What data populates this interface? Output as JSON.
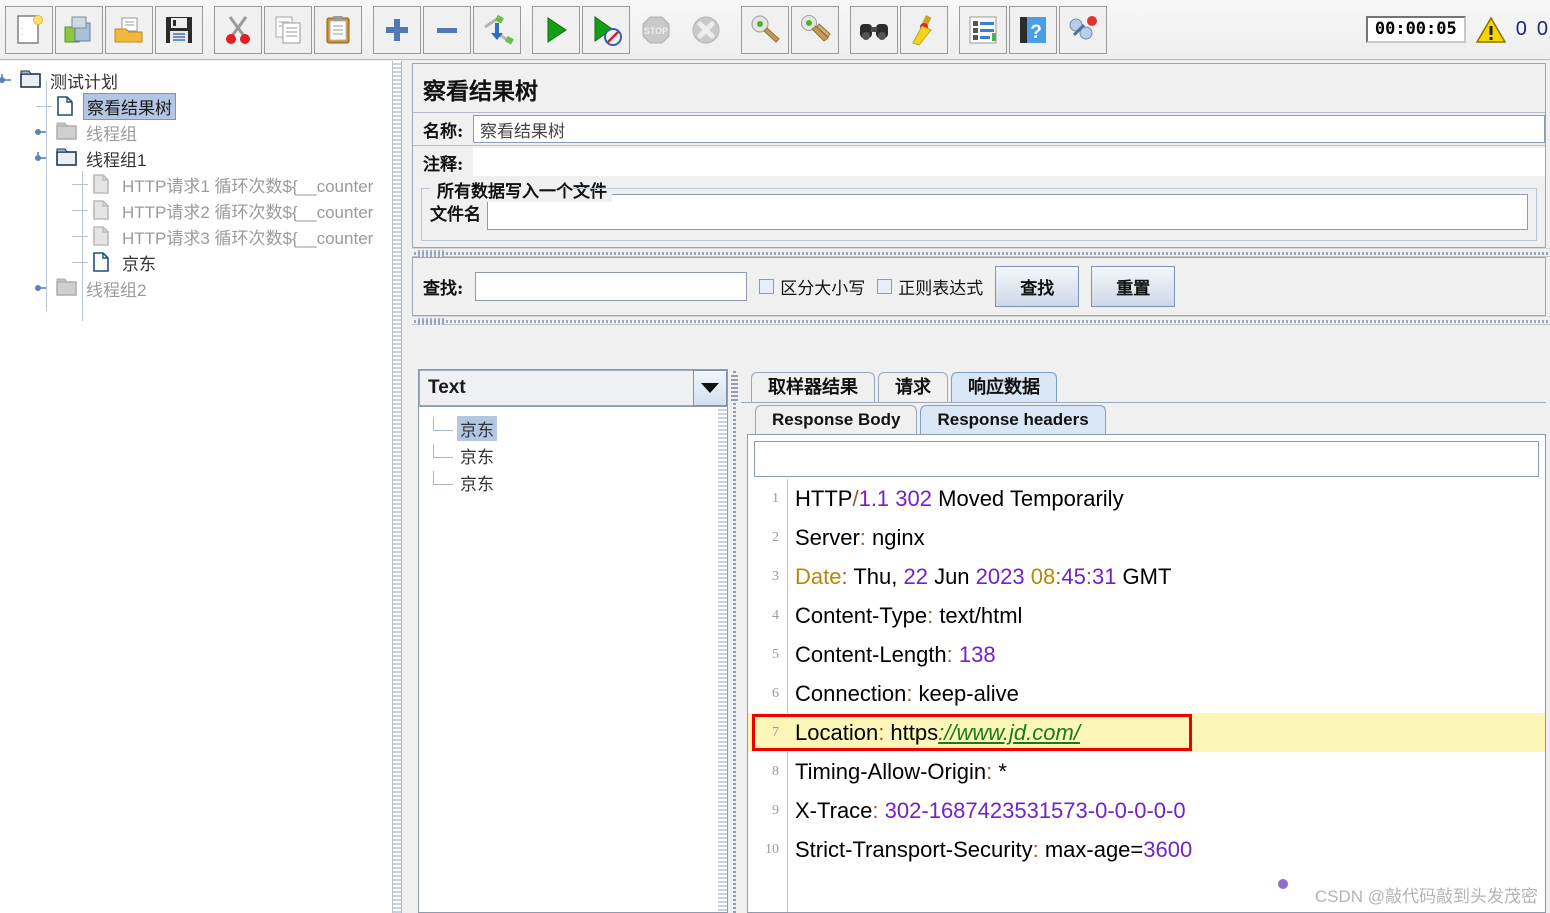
{
  "toolbar": {
    "buttons": [
      {
        "name": "new-icon",
        "title": "New"
      },
      {
        "name": "templates-icon",
        "title": "Templates"
      },
      {
        "name": "open-icon",
        "title": "Open"
      },
      {
        "name": "save-icon",
        "title": "Save"
      },
      {
        "name": "cut-icon",
        "title": "Cut"
      },
      {
        "name": "copy-icon",
        "title": "Copy"
      },
      {
        "name": "paste-icon",
        "title": "Paste"
      },
      {
        "name": "expand-all-icon",
        "title": "Expand all"
      },
      {
        "name": "collapse-all-icon",
        "title": "Collapse all"
      },
      {
        "name": "toggle-icon",
        "title": "Toggle"
      },
      {
        "name": "start-icon",
        "title": "Start"
      },
      {
        "name": "start-no-pauses-icon",
        "title": "Start no pauses"
      },
      {
        "name": "stop-icon",
        "title": "Stop"
      },
      {
        "name": "shutdown-icon",
        "title": "Shutdown"
      },
      {
        "name": "clear-icon",
        "title": "Clear"
      },
      {
        "name": "clear-all-icon",
        "title": "Clear all"
      },
      {
        "name": "search-icon",
        "title": "Search"
      },
      {
        "name": "reset-search-icon",
        "title": "Reset search"
      },
      {
        "name": "function-helper-icon",
        "title": "Function helper"
      },
      {
        "name": "help-icon",
        "title": "Help"
      },
      {
        "name": "undo-redo-icon",
        "title": "Undo"
      }
    ],
    "timer": "00:00:05",
    "warnings_count": "0",
    "extra_count": "0"
  },
  "tree": {
    "nodes": [
      {
        "label": "测试计划",
        "icon": "folder-open-icon",
        "indent": 20,
        "selected": false,
        "dim": false,
        "handle": "expanded"
      },
      {
        "label": "察看结果树",
        "icon": "page-icon",
        "indent": 56,
        "selected": true,
        "dim": false,
        "handle": "none"
      },
      {
        "label": "线程组",
        "icon": "folder-icon",
        "indent": 56,
        "selected": false,
        "dim": true,
        "handle": "collapsed"
      },
      {
        "label": "线程组1",
        "icon": "folder-open-icon",
        "indent": 56,
        "selected": false,
        "dim": false,
        "handle": "expanded"
      },
      {
        "label": "HTTP请求1 循环次数${__counter",
        "icon": "page-dim-icon",
        "indent": 92,
        "selected": false,
        "dim": true,
        "handle": "none"
      },
      {
        "label": "HTTP请求2 循环次数${__counter",
        "icon": "page-dim-icon",
        "indent": 92,
        "selected": false,
        "dim": true,
        "handle": "none"
      },
      {
        "label": "HTTP请求3 循环次数${__counter",
        "icon": "page-dim-icon",
        "indent": 92,
        "selected": false,
        "dim": true,
        "handle": "none"
      },
      {
        "label": "京东",
        "icon": "page-icon",
        "indent": 92,
        "selected": false,
        "dim": false,
        "handle": "none"
      },
      {
        "label": "线程组2",
        "icon": "folder-icon",
        "indent": 56,
        "selected": false,
        "dim": true,
        "handle": "collapsed"
      }
    ]
  },
  "panel": {
    "title": "察看结果树",
    "name_label": "名称:",
    "name_value": "察看结果树",
    "comment_label": "注释:",
    "comment_value": "",
    "group_legend": "所有数据写入一个文件",
    "filename_label": "文件名",
    "filename_value": ""
  },
  "search": {
    "label": "查找:",
    "value": "",
    "case_sensitive_label": "区分大小写",
    "regex_label": "正则表达式",
    "find_button": "查找",
    "reset_button": "重置"
  },
  "results": {
    "renderer_selected": "Text",
    "items": [
      {
        "label": "京东",
        "selected": true
      },
      {
        "label": "京东",
        "selected": false
      },
      {
        "label": "京东",
        "selected": false
      }
    ]
  },
  "tabs": {
    "main": [
      {
        "label": "取样器结果",
        "active": false
      },
      {
        "label": "请求",
        "active": false
      },
      {
        "label": "响应数据",
        "active": true
      }
    ],
    "sub": [
      {
        "label": "Response Body",
        "active": false
      },
      {
        "label": "Response headers",
        "active": true
      }
    ]
  },
  "filter": {
    "value": ""
  },
  "response_headers": {
    "highlight_line": 7,
    "lines": [
      {
        "n": "1",
        "parts": [
          {
            "t": "HTTP",
            "c": "k-default"
          },
          {
            "t": "/",
            "c": "v-punct"
          },
          {
            "t": "1.1",
            "c": "v-num"
          },
          {
            "t": " ",
            "c": "k-default"
          },
          {
            "t": "302",
            "c": "v-num"
          },
          {
            "t": " Moved Temporarily",
            "c": "k-default"
          }
        ]
      },
      {
        "n": "2",
        "parts": [
          {
            "t": "Server",
            "c": "k-default"
          },
          {
            "t": ":",
            "c": "v-punct"
          },
          {
            "t": " nginx",
            "c": "k-default"
          }
        ]
      },
      {
        "n": "3",
        "parts": [
          {
            "t": "Date",
            "c": "k-date"
          },
          {
            "t": ":",
            "c": "v-punct"
          },
          {
            "t": " Thu, ",
            "c": "k-default"
          },
          {
            "t": "22",
            "c": "v-num"
          },
          {
            "t": " Jun ",
            "c": "k-default"
          },
          {
            "t": "2023",
            "c": "v-num"
          },
          {
            "t": " ",
            "c": "k-default"
          },
          {
            "t": "08",
            "c": "k-date"
          },
          {
            "t": ":",
            "c": "v-punct"
          },
          {
            "t": "45",
            "c": "v-num"
          },
          {
            "t": ":",
            "c": "v-punct"
          },
          {
            "t": "31",
            "c": "v-num"
          },
          {
            "t": " GMT",
            "c": "k-default"
          }
        ]
      },
      {
        "n": "4",
        "parts": [
          {
            "t": "Content-Type",
            "c": "k-default"
          },
          {
            "t": ":",
            "c": "v-punct"
          },
          {
            "t": " text/html",
            "c": "k-default"
          }
        ]
      },
      {
        "n": "5",
        "parts": [
          {
            "t": "Content-Length",
            "c": "k-default"
          },
          {
            "t": ":",
            "c": "v-punct"
          },
          {
            "t": " ",
            "c": "k-default"
          },
          {
            "t": "138",
            "c": "v-num"
          }
        ]
      },
      {
        "n": "6",
        "parts": [
          {
            "t": "Connection",
            "c": "k-default"
          },
          {
            "t": ":",
            "c": "v-punct"
          },
          {
            "t": " keep-alive",
            "c": "k-default"
          }
        ]
      },
      {
        "n": "7",
        "parts": [
          {
            "t": "Location",
            "c": "k-default"
          },
          {
            "t": ":",
            "c": "v-punct"
          },
          {
            "t": " https",
            "c": "v-scheme"
          },
          {
            "t": "://",
            "c": "v-link"
          },
          {
            "t": "www.jd.com/",
            "c": "v-link"
          }
        ]
      },
      {
        "n": "8",
        "parts": [
          {
            "t": "Timing-Allow-Origin",
            "c": "k-default"
          },
          {
            "t": ":",
            "c": "v-punct"
          },
          {
            "t": " *",
            "c": "k-default"
          }
        ]
      },
      {
        "n": "9",
        "parts": [
          {
            "t": "X-Trace",
            "c": "k-default"
          },
          {
            "t": ":",
            "c": "v-punct"
          },
          {
            "t": " ",
            "c": "k-default"
          },
          {
            "t": "302-1687423531573-0-0-0-0-0",
            "c": "v-num"
          }
        ]
      },
      {
        "n": "10",
        "parts": [
          {
            "t": "Strict-Transport-Security",
            "c": "k-default"
          },
          {
            "t": ":",
            "c": "v-punct"
          },
          {
            "t": " max-age=",
            "c": "k-default"
          },
          {
            "t": "3600",
            "c": "v-num"
          }
        ]
      }
    ]
  },
  "watermark": "CSDN @敲代码敲到头发茂密",
  "colors": {
    "selection": "#b3c6e3",
    "tab_active": "#d8e6f5",
    "highlight": "#fbf6b8",
    "highlight_border": "#ef0000",
    "link": "#1a7a1a",
    "number": "#7322c8",
    "date_key": "#b8860b"
  }
}
